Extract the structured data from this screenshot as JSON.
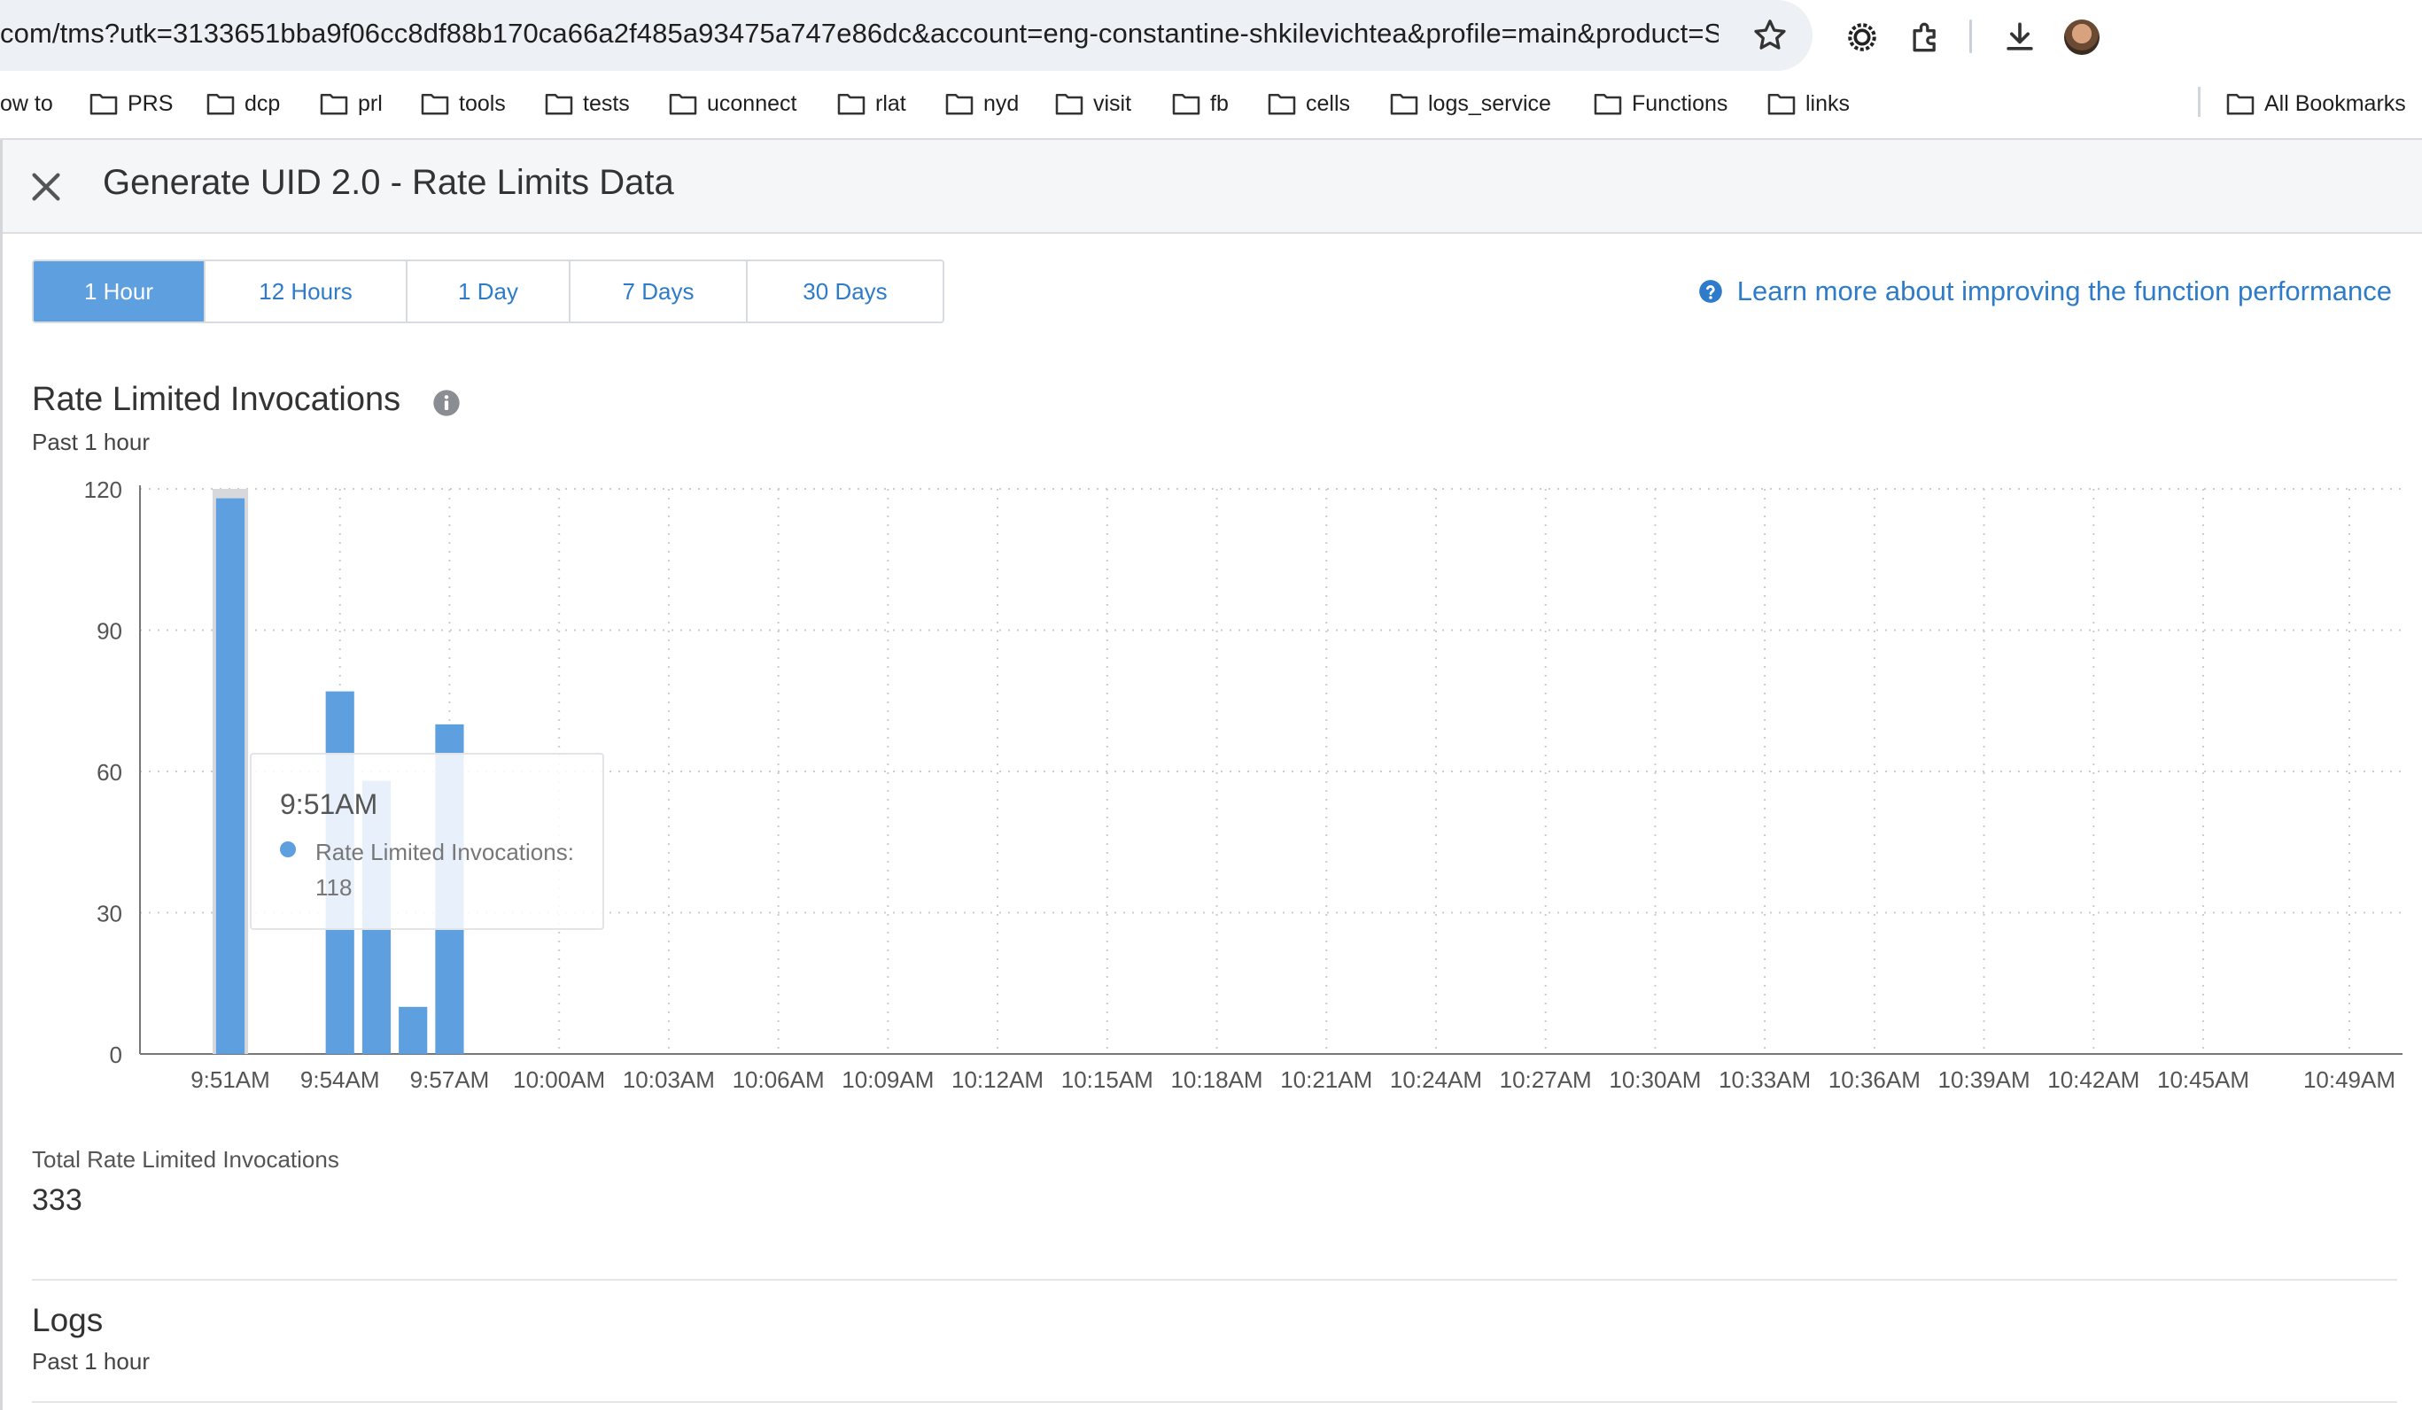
{
  "browser": {
    "url": "com/tms?utk=3133651bba9f06cc8df88b170ca66a2f485a93475a747e86dc&account=eng-constantine-shkilevichtea&profile=main&product=SS#/...",
    "bookmarks": [
      "ow to",
      "PRS",
      "dcp",
      "prl",
      "tools",
      "tests",
      "uconnect",
      "rlat",
      "nyd",
      "visit",
      "fb",
      "cells",
      "logs_service",
      "Functions",
      "links"
    ],
    "all_bookmarks_label": "All Bookmarks"
  },
  "panel": {
    "title": "Generate UID 2.0 - Rate Limits Data"
  },
  "range_tabs": [
    {
      "label": "1 Hour",
      "active": true
    },
    {
      "label": "12 Hours",
      "active": false
    },
    {
      "label": "1 Day",
      "active": false
    },
    {
      "label": "7 Days",
      "active": false
    },
    {
      "label": "30 Days",
      "active": false
    }
  ],
  "learn_more": {
    "label": "Learn more about improving the function performance"
  },
  "chart_section": {
    "title": "Rate Limited Invocations",
    "subtitle": "Past 1 hour"
  },
  "chart_data": {
    "type": "bar",
    "title": "Rate Limited Invocations",
    "subtitle": "Past 1 hour",
    "xlabel": "",
    "ylabel": "",
    "ylim": [
      0,
      120
    ],
    "yticks": [
      0,
      30,
      60,
      90,
      120
    ],
    "xticks": [
      "9:51AM",
      "9:54AM",
      "9:57AM",
      "10:00AM",
      "10:03AM",
      "10:06AM",
      "10:09AM",
      "10:12AM",
      "10:15AM",
      "10:18AM",
      "10:21AM",
      "10:24AM",
      "10:27AM",
      "10:30AM",
      "10:33AM",
      "10:36AM",
      "10:39AM",
      "10:42AM",
      "10:45AM",
      "10:49AM"
    ],
    "grid": true,
    "series": [
      {
        "name": "Rate Limited Invocations",
        "color": "#5e9fdf",
        "points": [
          {
            "x": "9:51AM",
            "y": 118
          },
          {
            "x": "9:54AM",
            "y": 77
          },
          {
            "x": "9:55AM",
            "y": 58
          },
          {
            "x": "9:56AM",
            "y": 10
          },
          {
            "x": "9:57AM",
            "y": 70
          }
        ]
      }
    ],
    "highlighted": "9:51AM"
  },
  "tooltip": {
    "time": "9:51AM",
    "label": "Rate Limited Invocations: 118"
  },
  "totals": {
    "label": "Total Rate Limited Invocations",
    "value": "333"
  },
  "logs": {
    "title": "Logs",
    "subtitle": "Past 1 hour"
  }
}
